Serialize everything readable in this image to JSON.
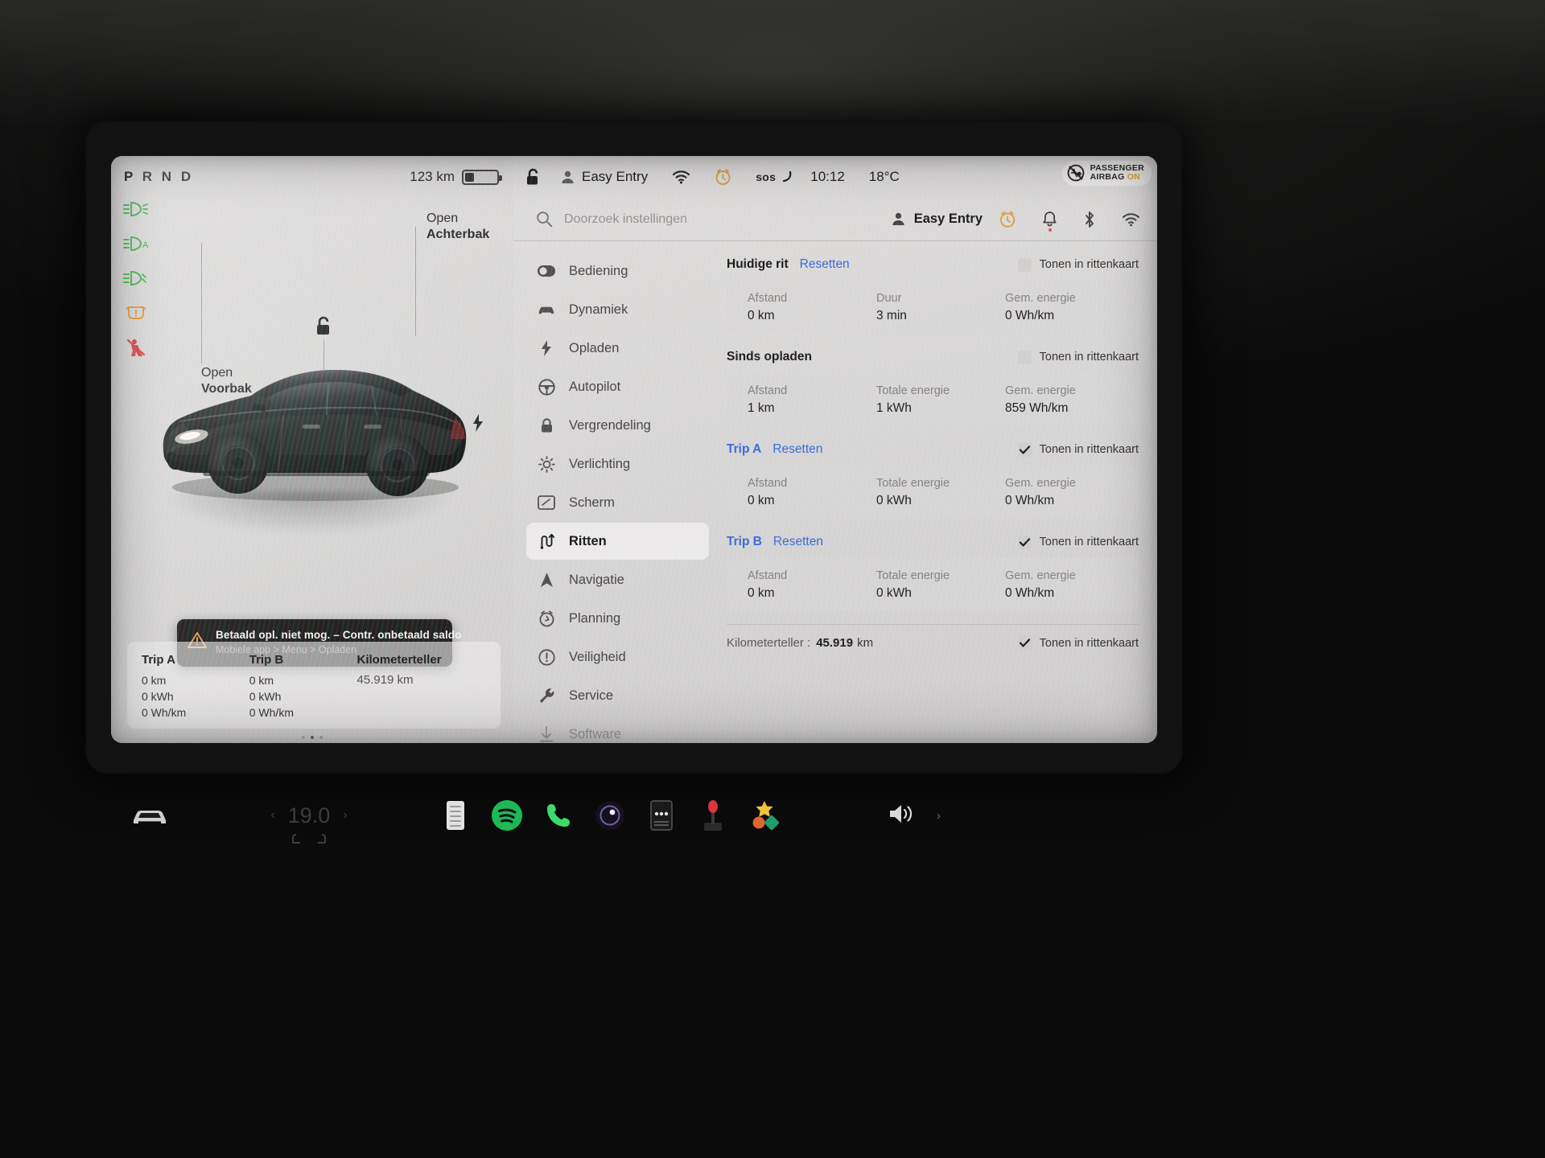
{
  "left_panel": {
    "gear_indicator": {
      "letters": [
        "P",
        "R",
        "N",
        "D"
      ],
      "active": "P"
    },
    "range": {
      "value": "123 km",
      "battery_level_pct": 26
    },
    "telltales": [
      {
        "name": "headlight-low-beam",
        "color": "#3cb54a"
      },
      {
        "name": "auto-highbeam",
        "color": "#3cb54a"
      },
      {
        "name": "fog-light",
        "color": "#3cb54a"
      },
      {
        "name": "tire-pressure-warning",
        "color": "#e0952a"
      },
      {
        "name": "seatbelt-warning",
        "color": "#d63c3c"
      }
    ],
    "car_hints": {
      "front_trunk": {
        "line1": "Open",
        "line2": "Voorbak"
      },
      "rear_trunk": {
        "line1": "Open",
        "line2": "Achterbak"
      }
    },
    "alert": {
      "title": "Betaald opl. niet mog. – Contr. onbetaald saldo",
      "subtitle": "Mobiele app > Menu > Opladen"
    },
    "trip_strip": {
      "columns": [
        {
          "header": "Trip A",
          "values": [
            "0 km",
            "0 kWh",
            "0 Wh/km"
          ]
        },
        {
          "header": "Trip B",
          "values": [
            "0 km",
            "0 kWh",
            "0 Wh/km"
          ]
        }
      ],
      "odometer": {
        "header": "Kilometerteller",
        "value": "45.919 km"
      }
    },
    "page_dots": {
      "count": 3,
      "active_index": 1
    }
  },
  "status_bar": {
    "lock_state": "unlocked",
    "profile": "Easy Entry",
    "sos_label": "sos",
    "time": "10:12",
    "temperature": "18°C",
    "airbag": {
      "line1": "PASSENGER",
      "line2": "AIRBAG",
      "state": "ON"
    }
  },
  "settings": {
    "search": {
      "placeholder": "Doorzoek instellingen"
    },
    "profile": "Easy Entry",
    "nav_items": [
      {
        "label": "Bediening",
        "icon": "toggle-icon",
        "selected": false,
        "faded": false
      },
      {
        "label": "Dynamiek",
        "icon": "car-icon",
        "selected": false,
        "faded": false
      },
      {
        "label": "Opladen",
        "icon": "bolt-icon",
        "selected": false,
        "faded": false
      },
      {
        "label": "Autopilot",
        "icon": "steering-wheel-icon",
        "selected": false,
        "faded": false
      },
      {
        "label": "Vergrendeling",
        "icon": "lock-icon",
        "selected": false,
        "faded": false
      },
      {
        "label": "Verlichting",
        "icon": "sun-icon",
        "selected": false,
        "faded": false
      },
      {
        "label": "Scherm",
        "icon": "display-icon",
        "selected": false,
        "faded": false
      },
      {
        "label": "Ritten",
        "icon": "route-icon",
        "selected": true,
        "faded": false
      },
      {
        "label": "Navigatie",
        "icon": "navigation-arrow-icon",
        "selected": false,
        "faded": false
      },
      {
        "label": "Planning",
        "icon": "clock-icon",
        "selected": false,
        "faded": false
      },
      {
        "label": "Veiligheid",
        "icon": "alert-circle-icon",
        "selected": false,
        "faded": false
      },
      {
        "label": "Service",
        "icon": "wrench-icon",
        "selected": false,
        "faded": false
      },
      {
        "label": "Software",
        "icon": "download-icon",
        "selected": false,
        "faded": true
      }
    ],
    "trips_pane": {
      "show_in_trip_card_label": "Tonen in rittenkaart",
      "reset_label": "Resetten",
      "sections": [
        {
          "title": "Huidige rit",
          "title_is_link": false,
          "has_reset": true,
          "show_in_card": false,
          "stats": [
            {
              "label": "Afstand",
              "value": "0 km"
            },
            {
              "label": "Duur",
              "value": "3 min"
            },
            {
              "label": "Gem. energie",
              "value": "0 Wh/km"
            }
          ]
        },
        {
          "title": "Sinds opladen",
          "title_is_link": false,
          "has_reset": false,
          "show_in_card": false,
          "stats": [
            {
              "label": "Afstand",
              "value": "1 km"
            },
            {
              "label": "Totale energie",
              "value": "1 kWh"
            },
            {
              "label": "Gem. energie",
              "value": "859 Wh/km"
            }
          ]
        },
        {
          "title": "Trip A",
          "title_is_link": true,
          "has_reset": true,
          "show_in_card": true,
          "stats": [
            {
              "label": "Afstand",
              "value": "0 km"
            },
            {
              "label": "Totale energie",
              "value": "0 kWh"
            },
            {
              "label": "Gem. energie",
              "value": "0 Wh/km"
            }
          ]
        },
        {
          "title": "Trip B",
          "title_is_link": true,
          "has_reset": true,
          "show_in_card": true,
          "stats": [
            {
              "label": "Afstand",
              "value": "0 km"
            },
            {
              "label": "Totale energie",
              "value": "0 kWh"
            },
            {
              "label": "Gem. energie",
              "value": "0 Wh/km"
            }
          ]
        }
      ],
      "odometer": {
        "label": "Kilometerteller :",
        "value": "45.919",
        "unit": "km",
        "show_in_card": true
      }
    }
  },
  "dock": {
    "car_icon": "car-icon",
    "climate": {
      "temperature": "19.0",
      "left_arrow": "‹",
      "right_arrow": "›"
    },
    "apps": [
      {
        "name": "media-equalizer-icon"
      },
      {
        "name": "spotify-icon",
        "color": "#1db954"
      },
      {
        "name": "phone-icon",
        "color": "#3ddc6a"
      },
      {
        "name": "dashcam-icon"
      },
      {
        "name": "more-dots-icon"
      },
      {
        "name": "arcade-joystick-icon"
      },
      {
        "name": "theater-apps-icon"
      }
    ],
    "volume_icon": "speaker-icon",
    "chevron": "›"
  }
}
